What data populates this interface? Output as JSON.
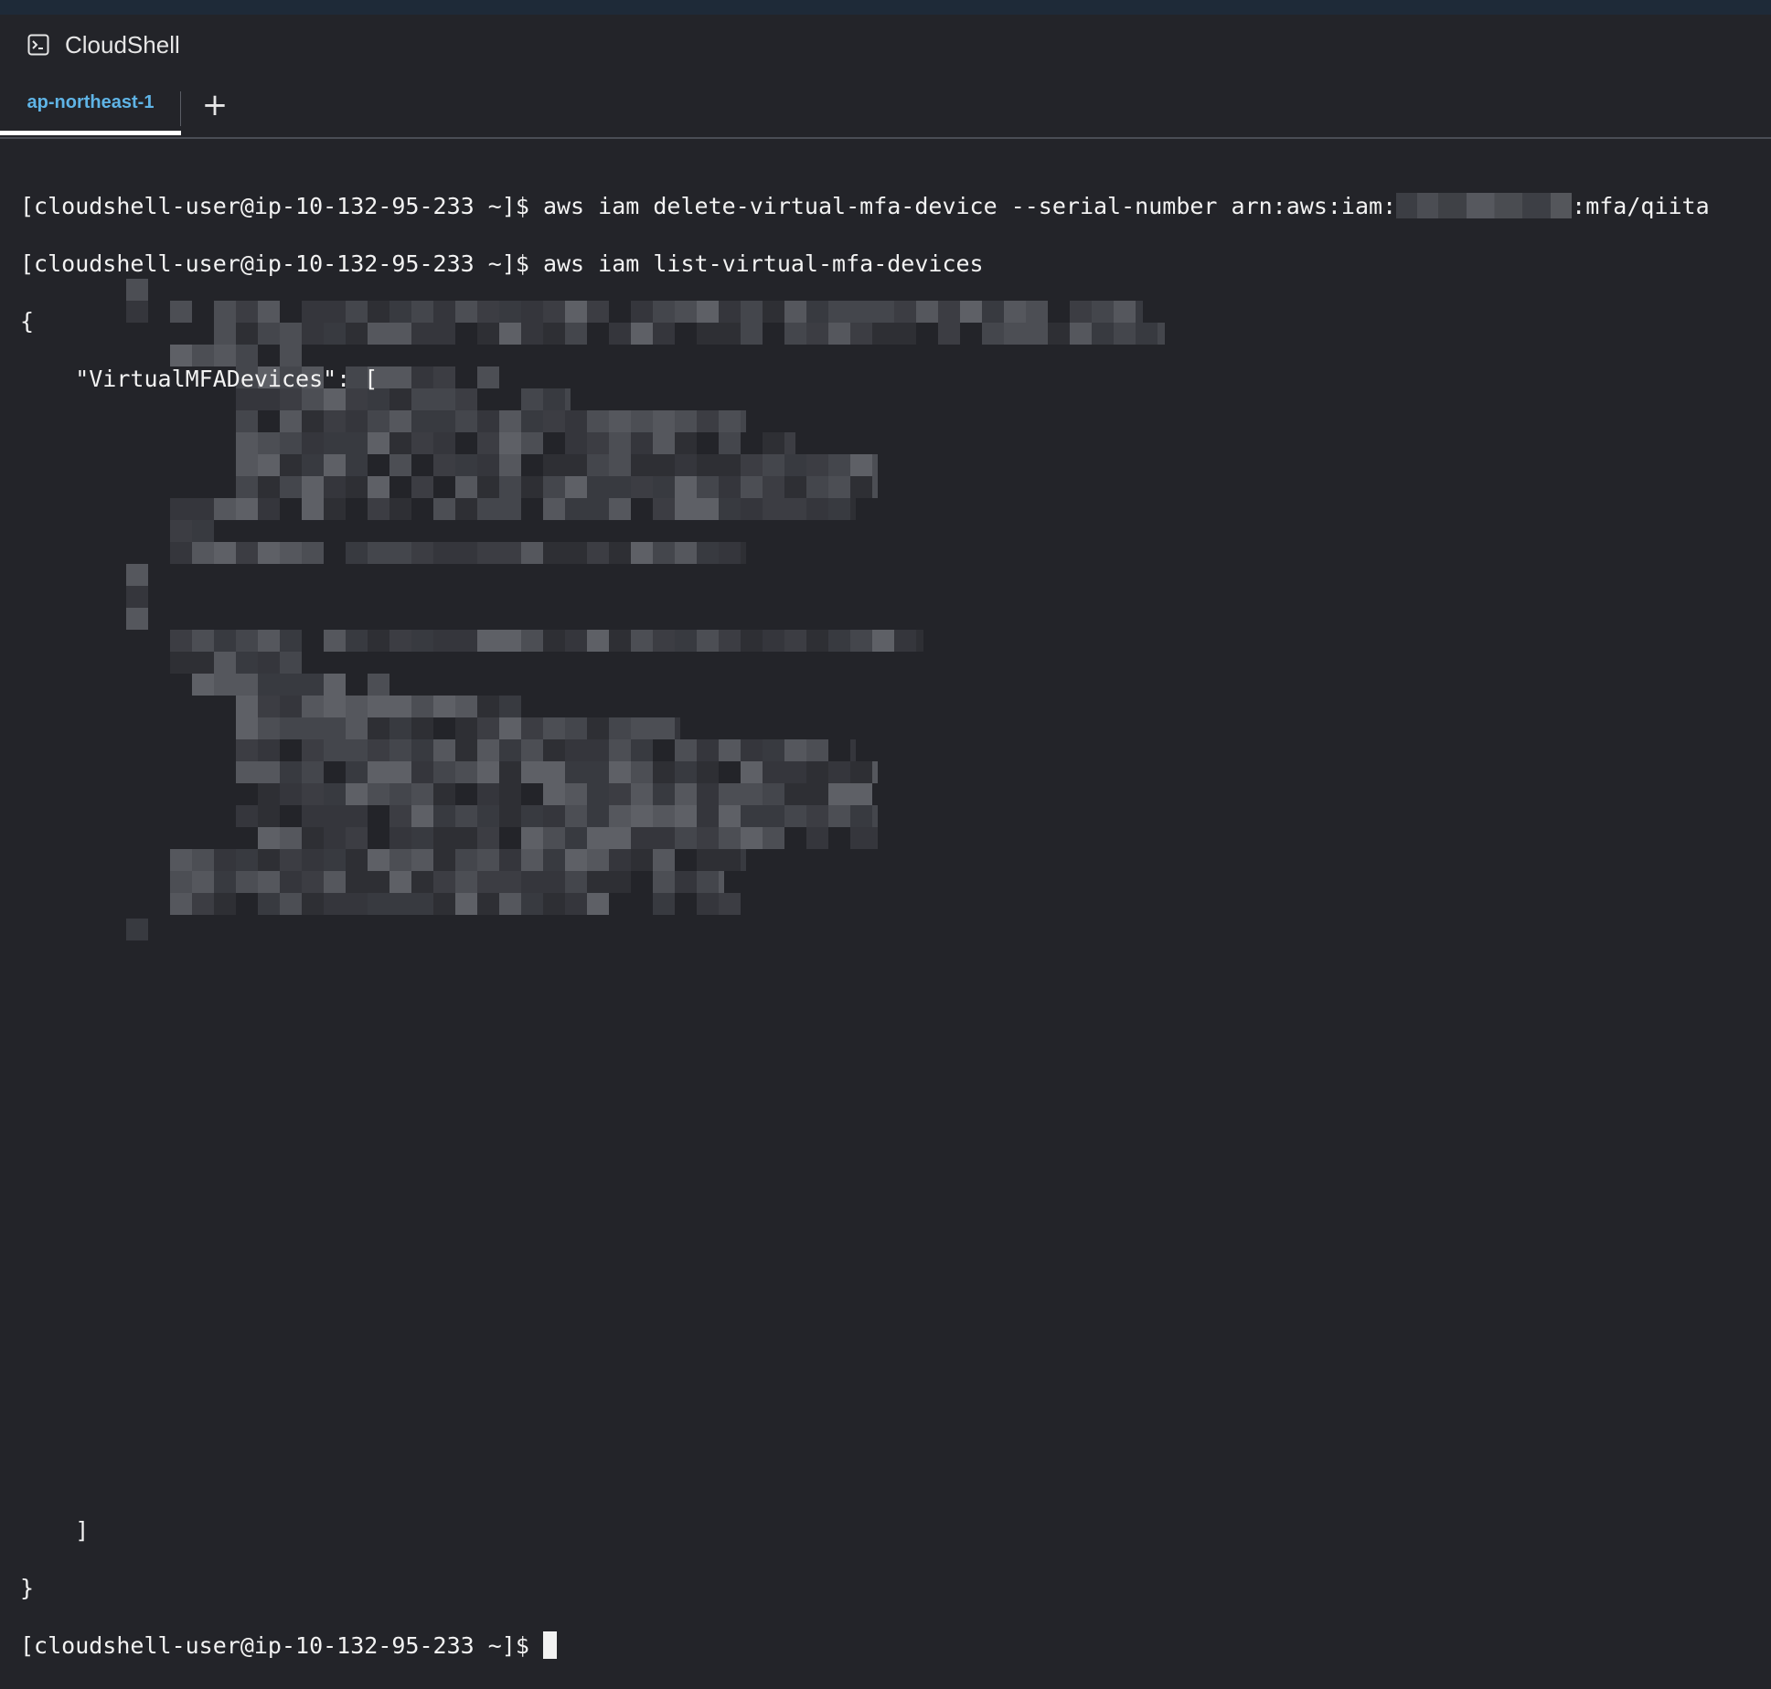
{
  "app": {
    "title": "CloudShell",
    "icon": "terminal-icon"
  },
  "tabs": [
    {
      "label": "ap-northeast-1",
      "active": true
    }
  ],
  "add_tab_label": "+",
  "terminal": {
    "prompt": "[cloudshell-user@ip-10-132-95-233 ~]$",
    "lines": [
      {
        "command": " aws iam delete-virtual-mfa-device --serial-number arn:aws:iam:",
        "suffix": ":mfa/qiita"
      },
      {
        "command": " aws iam list-virtual-mfa-devices"
      }
    ],
    "output_open": "{",
    "output_key": "    \"VirtualMFADevices\": [",
    "output_close_array": "    ]",
    "output_close": "}"
  },
  "colors": {
    "background": "#232429",
    "tab_accent": "#5fb4e6",
    "text": "#f2f2f2"
  }
}
